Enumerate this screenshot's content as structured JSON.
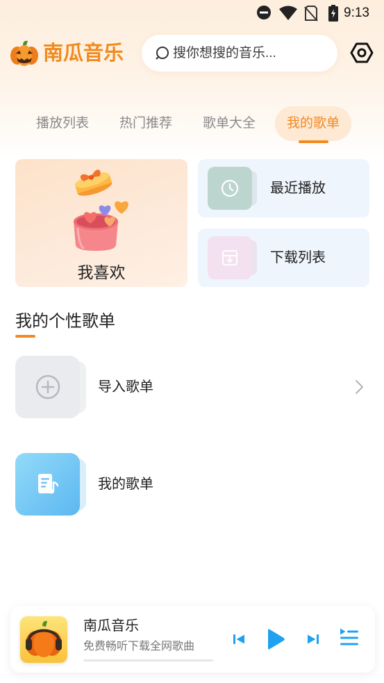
{
  "status_bar": {
    "time": "9:13",
    "icons": [
      "do-not-disturb-icon",
      "wifi-icon",
      "no-sim-icon",
      "battery-charging-icon"
    ]
  },
  "header": {
    "app_name": "南瓜音乐",
    "logo_icon": "pumpkin-logo-icon",
    "search": {
      "placeholder": "搜你想搜的音乐...",
      "icon": "search-icon"
    },
    "settings_icon": "settings-icon"
  },
  "tabs": [
    {
      "label": "播放列表",
      "active": false
    },
    {
      "label": "热门推荐",
      "active": false
    },
    {
      "label": "歌单大全",
      "active": false
    },
    {
      "label": "我的歌单",
      "active": true
    }
  ],
  "quick_access": {
    "favorites": {
      "label": "我喜欢",
      "icon": "gift-box-hearts-icon"
    },
    "recent": {
      "label": "最近播放",
      "icon": "clock-icon"
    },
    "downloads": {
      "label": "下载列表",
      "icon": "download-tray-icon"
    }
  },
  "custom_playlists": {
    "title": "我的个性歌单",
    "items": [
      {
        "label": "导入歌单",
        "icon": "add-circle-icon",
        "trailing_icon": "chevron-right-icon"
      },
      {
        "label": "我的歌单",
        "icon": "music-document-icon"
      }
    ]
  },
  "player": {
    "title": "南瓜音乐",
    "subtitle": "免费畅听下载全网歌曲",
    "cover_icon": "pumpkin-headphones-icon",
    "progress": 0,
    "controls": [
      "previous-icon",
      "play-icon",
      "next-icon",
      "playlist-queue-icon"
    ]
  },
  "colors": {
    "accent": "#f28a1e",
    "active_tab_bg": "#fde9d4",
    "favorites_card_bg": "#fde6d2",
    "side_card_bg": "#eef5fd",
    "recent_tile": "#bcd6cf",
    "downloads_tile": "#f3e1f2",
    "import_tile": "#e9ebee",
    "my_playlist_tile": "#6ec4f4",
    "player_control": "#1ea1f1"
  }
}
